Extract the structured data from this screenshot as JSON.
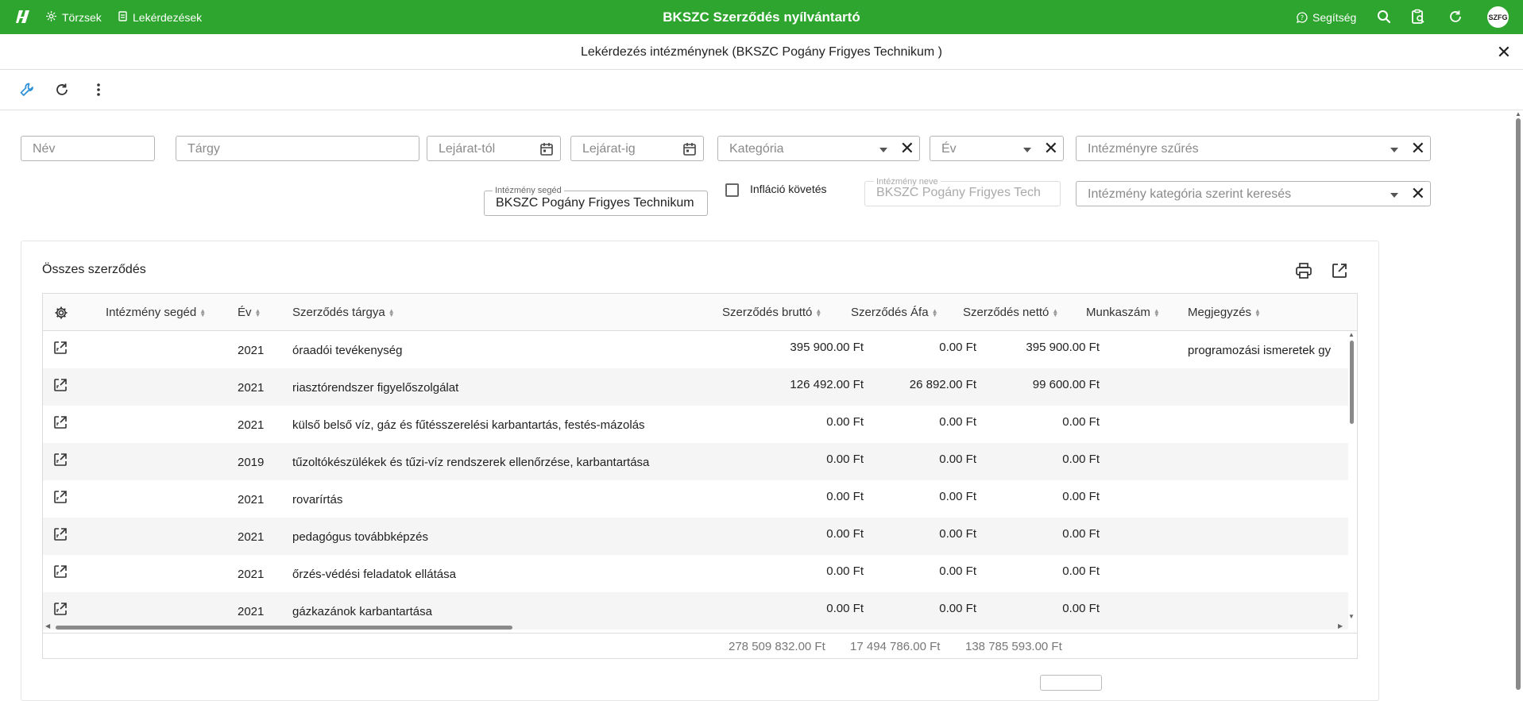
{
  "app": {
    "title": "BKSZC Szerződés nyílvántartó",
    "nav": [
      {
        "label": "Törzsek",
        "icon": "sliders-icon"
      },
      {
        "label": "Lekérdezések",
        "icon": "document-icon"
      }
    ],
    "help_label": "Segítség",
    "avatar_initials": "SZFG",
    "brand_color": "#2ea52e"
  },
  "subheader": {
    "title": "Lekérdezés intézménynek (BKSZC Pogány Frigyes Technikum )"
  },
  "filters": {
    "nev_placeholder": "Név",
    "targy_placeholder": "Tárgy",
    "lejarat_tol_placeholder": "Lejárat-tól",
    "lejarat_ig_placeholder": "Lejárat-ig",
    "kategoria_placeholder": "Kategória",
    "ev_placeholder": "Év",
    "intezmenyre_szures_placeholder": "Intézményre szűrés",
    "intezmeny_seged_label": "Intézmény segéd",
    "intezmeny_seged_value": "BKSZC Pogány Frigyes Technikum",
    "inflacio_label": "Infláció követés",
    "intezmeny_neve_label": "Intézmény neve",
    "intezmeny_neve_value": "BKSZC Pogány Frigyes Tech",
    "kategoria_kereses_placeholder": "Intézmény kategória szerint keresés"
  },
  "card": {
    "title": "Összes szerződés"
  },
  "table": {
    "columns": [
      "Intézmény segéd",
      "Év",
      "Szerződés tárgya",
      "Szerződés bruttó",
      "Szerződés Áfa",
      "Szerződés nettó",
      "Munkaszám",
      "Megjegyzés"
    ],
    "rows": [
      {
        "ev": "2021",
        "targy": "óraadói tevékenység",
        "brutto": "395 900.00 Ft",
        "afa": "0.00 Ft",
        "netto": "395 900.00 Ft",
        "megjegyzes": "programozási ismeretek gy"
      },
      {
        "ev": "2021",
        "targy": "riasztórendszer figyelőszolgálat",
        "brutto": "126 492.00 Ft",
        "afa": "26 892.00 Ft",
        "netto": "99 600.00 Ft",
        "megjegyzes": ""
      },
      {
        "ev": "2021",
        "targy": "külső belső víz, gáz és fűtésszerelési karbantartás, festés-mázolás",
        "brutto": "0.00 Ft",
        "afa": "0.00 Ft",
        "netto": "0.00 Ft",
        "megjegyzes": ""
      },
      {
        "ev": "2019",
        "targy": "tűzoltókészülékek és tűzi-víz rendszerek ellenőrzése, karbantartása",
        "brutto": "0.00 Ft",
        "afa": "0.00 Ft",
        "netto": "0.00 Ft",
        "megjegyzes": ""
      },
      {
        "ev": "2021",
        "targy": "rovarírtás",
        "brutto": "0.00 Ft",
        "afa": "0.00 Ft",
        "netto": "0.00 Ft",
        "megjegyzes": ""
      },
      {
        "ev": "2021",
        "targy": "pedagógus továbbképzés",
        "brutto": "0.00 Ft",
        "afa": "0.00 Ft",
        "netto": "0.00 Ft",
        "megjegyzes": ""
      },
      {
        "ev": "2021",
        "targy": "őrzés-védési feladatok ellátása",
        "brutto": "0.00 Ft",
        "afa": "0.00 Ft",
        "netto": "0.00 Ft",
        "megjegyzes": ""
      },
      {
        "ev": "2021",
        "targy": "gázkazánok karbantartása",
        "brutto": "0.00 Ft",
        "afa": "0.00 Ft",
        "netto": "0.00 Ft",
        "megjegyzes": ""
      }
    ],
    "totals": {
      "brutto": "278 509 832.00 Ft",
      "afa": "17 494 786.00 Ft",
      "netto": "138 785 593.00 Ft"
    }
  }
}
